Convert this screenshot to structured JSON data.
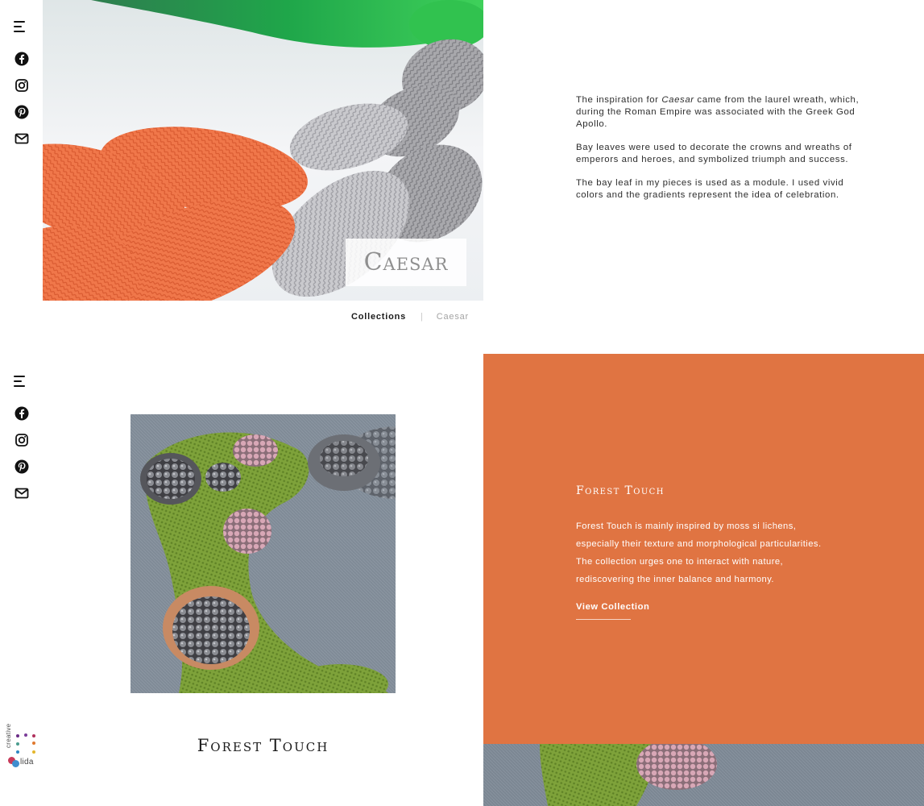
{
  "rail": {
    "icons": [
      "menu-icon",
      "facebook-icon",
      "instagram-icon",
      "pinterest-icon",
      "mail-icon"
    ]
  },
  "caesar": {
    "badge_text": "Caesar",
    "breadcrumb": {
      "link_label": "Collections",
      "separator": "|",
      "current_label": "Caesar"
    },
    "description": {
      "p1_before": "The inspiration for ",
      "p1_em": "Caesar",
      "p1_after": " came from the laurel wreath, which, during the Roman Empire was associated with the Greek God Apollo.",
      "p2": "Bay leaves were used to decorate the crowns and wreaths of emperors and heroes, and symbolized triumph and success.",
      "p3": "The bay leaf in my pieces is used as a module. I used vivid colors and the gradients represent the idea of celebration."
    }
  },
  "forest_touch": {
    "title": "Forest Touch",
    "panel": {
      "heading": "Forest Touch",
      "lines": [
        "Forest Touch is mainly inspired by moss si lichens,",
        "especially their texture and morphological particularities.",
        "The collection urges one to interact with nature,",
        "rediscovering the inner balance and harmony."
      ],
      "link_label": "View Collection"
    }
  },
  "logo": {
    "word_top": "creative",
    "word_bottom": "lida"
  },
  "colors": {
    "accent_orange": "#e07442",
    "text_dark": "#2e2e2e",
    "breadcrumb_muted": "#a4a4a4"
  }
}
